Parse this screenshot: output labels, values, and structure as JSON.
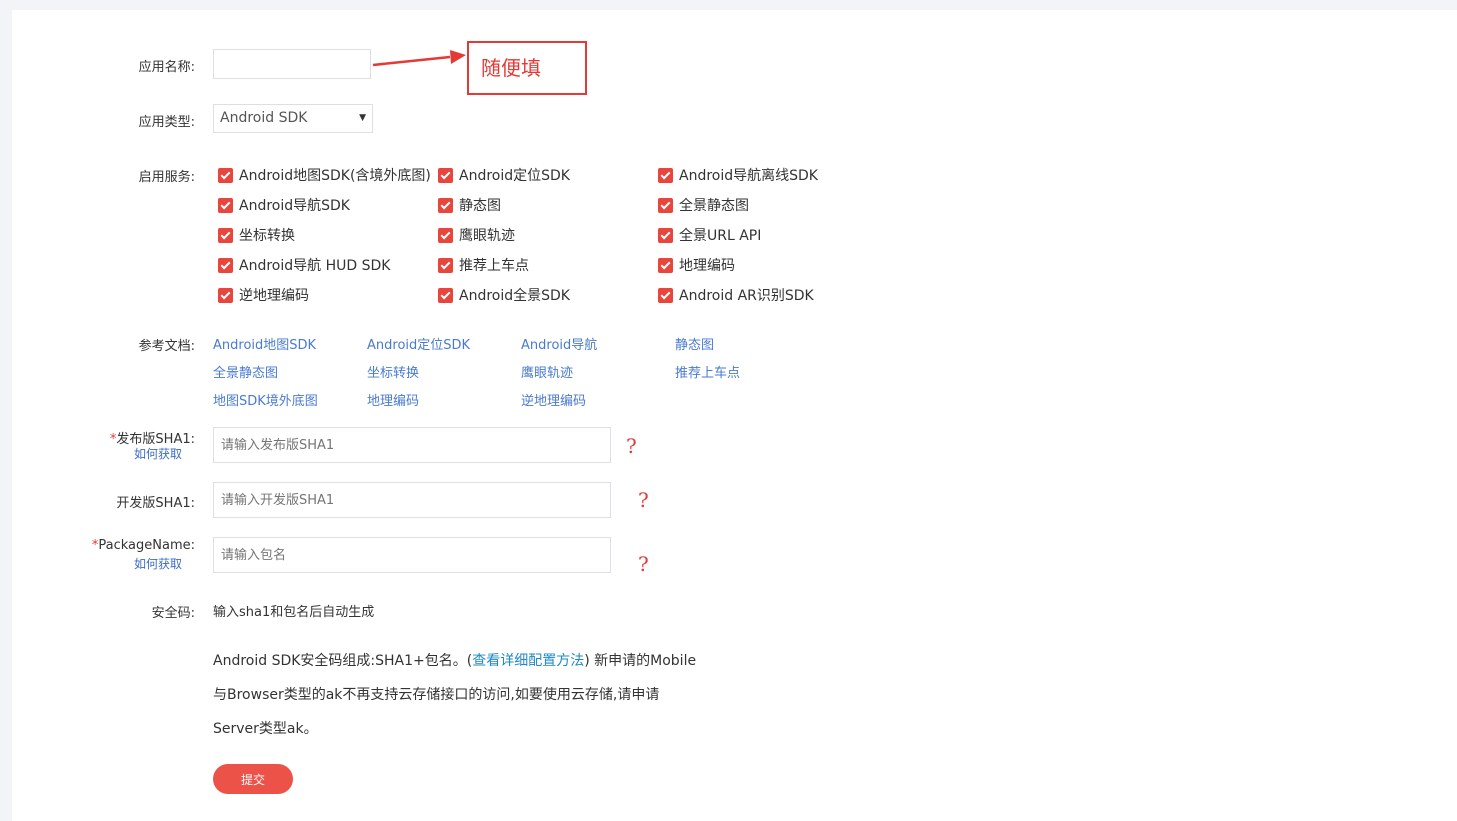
{
  "form": {
    "app_name": {
      "label": "应用名称:",
      "value": ""
    },
    "app_type": {
      "label": "应用类型:",
      "value": "Android SDK"
    },
    "services": {
      "label": "启用服务:",
      "items": [
        "Android地图SDK(含境外底图)",
        "Android定位SDK",
        "Android导航离线SDK",
        "Android导航SDK",
        "静态图",
        "全景静态图",
        "坐标转换",
        "鹰眼轨迹",
        "全景URL API",
        "Android导航 HUD SDK",
        "推荐上车点",
        "地理编码",
        "逆地理编码",
        "Android全景SDK",
        "Android AR识别SDK"
      ]
    },
    "docs": {
      "label": "参考文档:",
      "items": [
        "Android地图SDK",
        "Android定位SDK",
        "Android导航",
        "静态图",
        "全景静态图",
        "坐标转换",
        "鹰眼轨迹",
        "推荐上车点",
        "地图SDK境外底图",
        "地理编码",
        "逆地理编码"
      ]
    },
    "release_sha1": {
      "required_mark": "*",
      "label": "发布版SHA1:",
      "help": "如何获取",
      "placeholder": "请输入发布版SHA1"
    },
    "dev_sha1": {
      "label": "开发版SHA1:",
      "placeholder": "请输入开发版SHA1"
    },
    "package_name": {
      "required_mark": "*",
      "label": "PackageName:",
      "help": "如何获取",
      "placeholder": "请输入包名"
    },
    "security_code": {
      "label": "安全码:",
      "value": "输入sha1和包名后自动生成"
    },
    "note": {
      "line1_pre": "Android SDK安全码组成:SHA1+包名。(",
      "line1_link": "查看详细配置方法",
      "line1_post": ") 新申请的Mobile",
      "line2": "与Browser类型的ak不再支持云存储接口的访问,如要使用云存储,请申请",
      "line3": "Server类型ak。"
    },
    "submit_label": "提交"
  },
  "annotations": {
    "callout_text": "随便填",
    "question_mark": "?"
  },
  "colors": {
    "accent": "#e8453c",
    "link": "#4a7ad0",
    "annotation": "#e53935"
  }
}
